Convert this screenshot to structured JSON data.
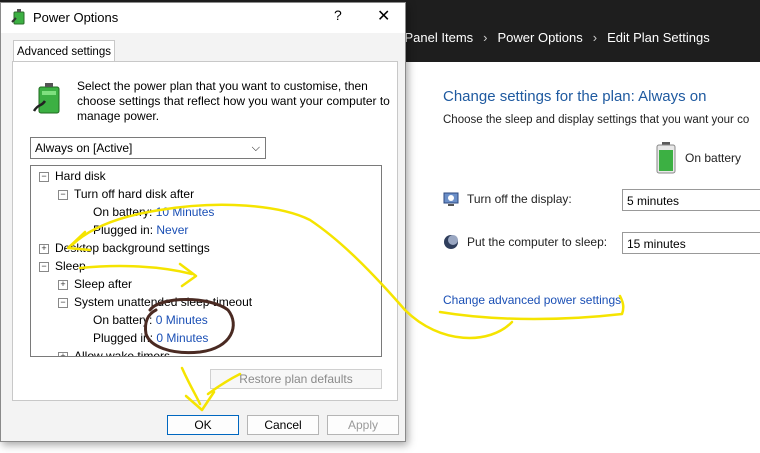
{
  "background": {
    "breadcrumb": [
      "l Panel Items",
      "Power Options",
      "Edit Plan Settings"
    ],
    "plan_title": "Change settings for the plan: Always on",
    "plan_subtitle": "Choose the sleep and display settings that you want your co",
    "battery_header": "On battery",
    "display_label": "Turn off the display:",
    "display_value": "5 minutes",
    "sleep_label": "Put the computer to sleep:",
    "sleep_value": "15 minutes",
    "advanced_link": "Change advanced power settings"
  },
  "dialog": {
    "title": "Power Options",
    "help": "?",
    "close": "✕",
    "tab": "Advanced settings",
    "description": "Select the power plan that you want to customise, then choose settings that reflect how you want your computer to manage power.",
    "plan_selected": "Always on [Active]",
    "tree": {
      "hard_disk": "Hard disk",
      "turn_off_hd": "Turn off hard disk after",
      "on_battery_label": "On battery:",
      "on_battery_value": "10 Minutes",
      "plugged_in_label": "Plugged in:",
      "plugged_in_value": "Never",
      "desktop_bg": "Desktop background settings",
      "sleep": "Sleep",
      "sleep_after": "Sleep after",
      "system_unattended": "System unattended sleep timeout",
      "su_battery_label": "On battery:",
      "su_battery_value": "0 Minutes",
      "su_plugged_label": "Plugged in:",
      "su_plugged_value": "0 Minutes",
      "allow_wake": "Allow wake timers"
    },
    "restore_button": "Restore plan defaults",
    "ok_button": "OK",
    "cancel_button": "Cancel",
    "apply_button": "Apply"
  },
  "colors": {
    "accent": "#0078d7",
    "link": "#1a4fb5",
    "annotation_yellow": "#f5e400",
    "annotation_brown": "#4a2a22"
  }
}
